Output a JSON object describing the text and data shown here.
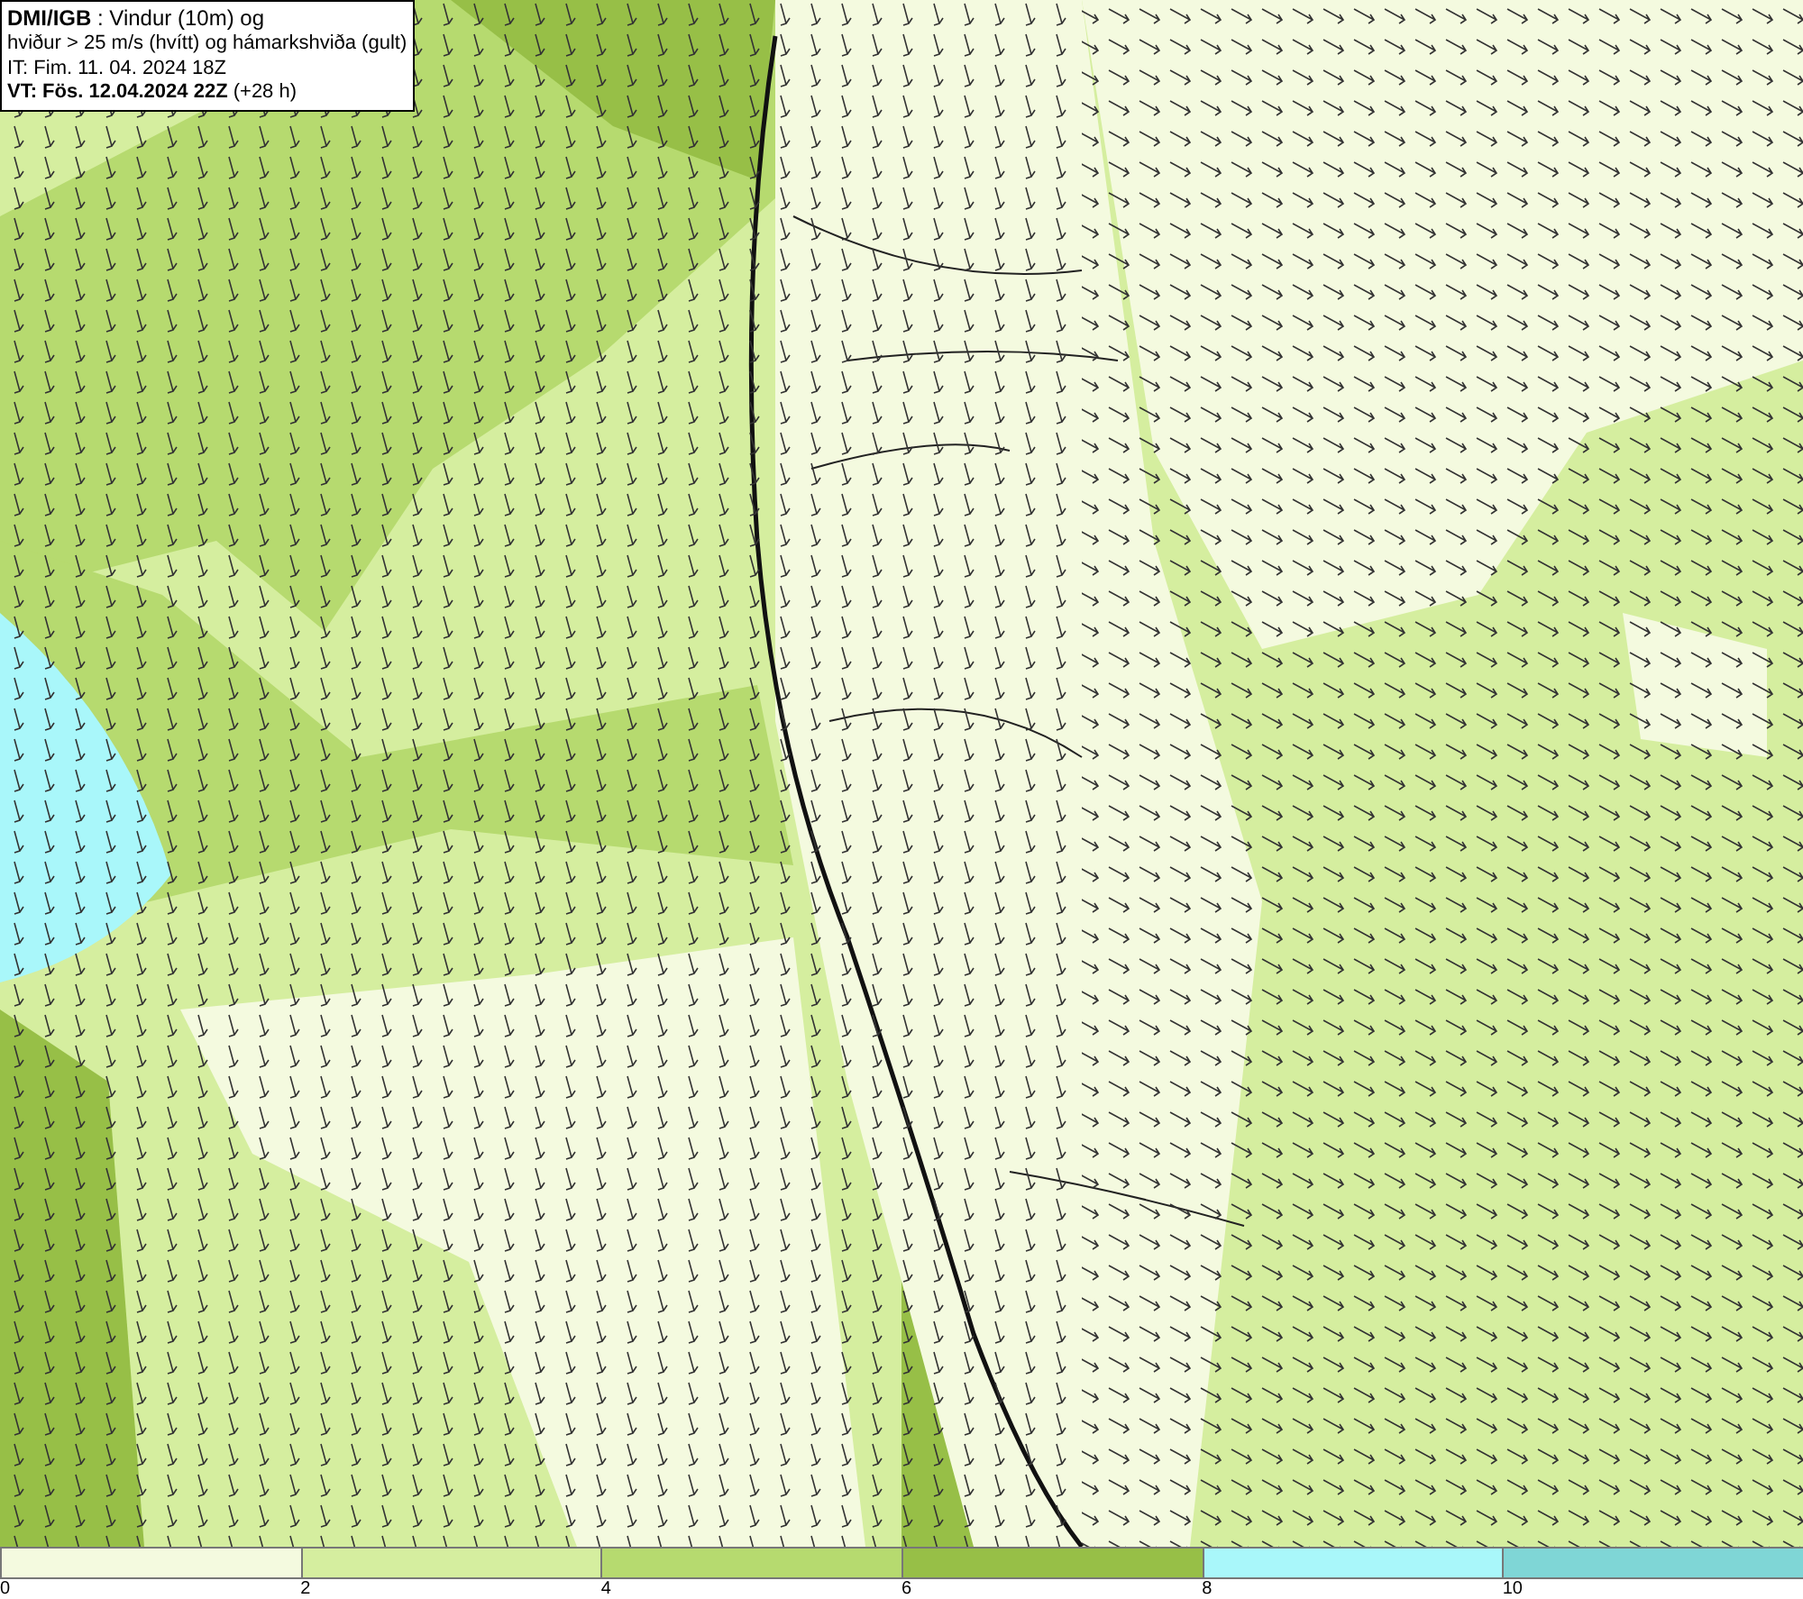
{
  "header": {
    "lines": [
      "**DMI/IGB** : Vindur (10m) og",
      "hviður > 25 m/s (hvítt) og hámarkshviða (gult)",
      "IT: Fim. 11. 04. 2024 18Z",
      "**VT: Fös. 12.04.2024 22Z** (+28 h)"
    ]
  },
  "legend": {
    "segments": [
      {
        "color": "#f4fadf"
      },
      {
        "color": "#d5ee9f"
      },
      {
        "color": "#b6da6f"
      },
      {
        "color": "#97bf47"
      },
      {
        "color": "#a9f7fa"
      },
      {
        "color": "#7fd6d6"
      }
    ],
    "labels": [
      "0",
      "2",
      "4",
      "6",
      "8",
      "10"
    ]
  }
}
